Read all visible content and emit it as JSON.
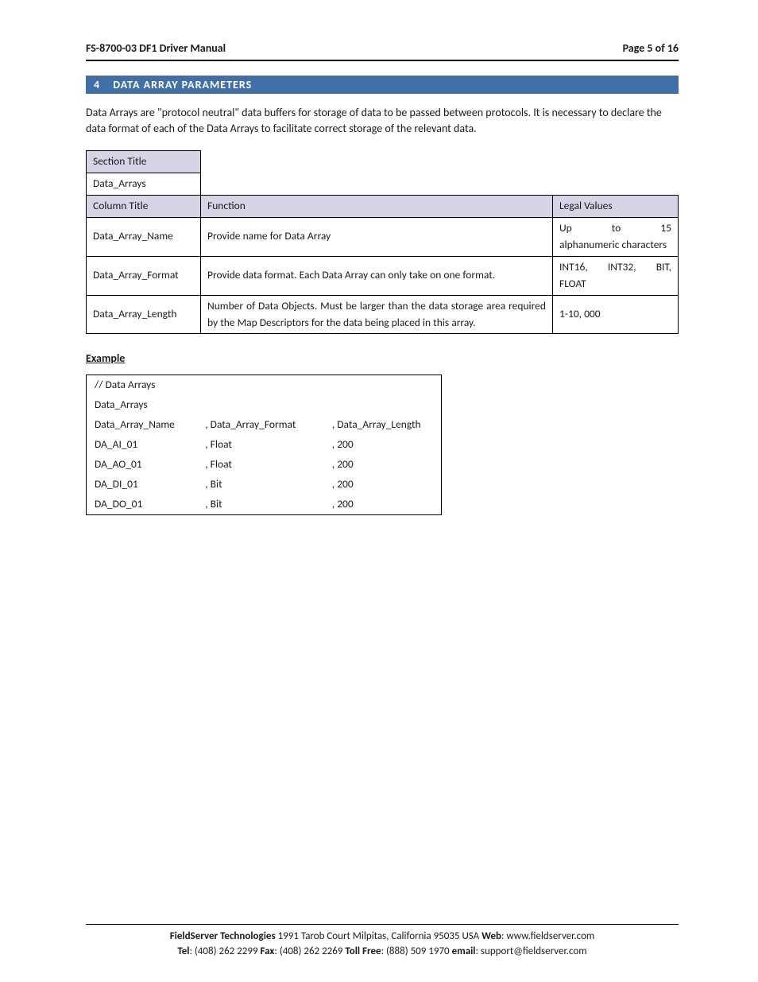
{
  "header": {
    "title": "FS-8700-03 DF1 Driver Manual",
    "page_text": "Page 5 of 16"
  },
  "section": {
    "number": "4",
    "title": "DATA ARRAY PARAMETERS"
  },
  "intro_text": "Data Arrays are \"protocol neutral\" data buffers for storage of data to be passed between protocols.  It is necessary to declare the data format of each of the Data Arrays to facilitate correct storage of the relevant data.",
  "params_table": {
    "section_title_label": "Section Title",
    "section_title_value": "Data_Arrays",
    "column_title_label": "Column Title",
    "function_label": "Function",
    "legal_values_label": "Legal Values",
    "rows": [
      {
        "name": "Data_Array_Name",
        "function": "Provide name for Data Array",
        "legal": "Up to 15 alphanumeric characters"
      },
      {
        "name": "Data_Array_Format",
        "function": "Provide data format. Each Data Array can only take on one format.",
        "legal": "INT16, INT32, BIT, FLOAT"
      },
      {
        "name": "Data_Array_Length",
        "function": "Number of Data Objects. Must be larger than the data storage area required by the Map Descriptors for the data being placed in this array.",
        "legal": "1-10, 000"
      }
    ]
  },
  "example_label": "Example",
  "example_table": {
    "comment": "//    Data Arrays",
    "section": "Data_Arrays",
    "headers": {
      "c1": "Data_Array_Name",
      "c2": ", Data_Array_Format",
      "c3": ", Data_Array_Length"
    },
    "rows": [
      {
        "c1": "DA_AI_01",
        "c2": ", Float",
        "c3": ", 200"
      },
      {
        "c1": "DA_AO_01",
        "c2": ", Float",
        "c3": ", 200"
      },
      {
        "c1": "DA_DI_01",
        "c2": ", Bit",
        "c3": ", 200"
      },
      {
        "c1": "DA_DO_01",
        "c2": ", Bit",
        "c3": ", 200"
      }
    ]
  },
  "footer": {
    "line1_company": "FieldServer Technologies",
    "line1_address": " 1991 Tarob Court Milpitas, California 95035 USA   ",
    "line1_web_label": "Web",
    "line1_web_value": ": www.fieldserver.com",
    "line2_tel_label": "Tel",
    "line2_tel_value": ": (408) 262 2299   ",
    "line2_fax_label": "Fax",
    "line2_fax_value": ": (408) 262 2269   ",
    "line2_tollfree_label": "Toll Free",
    "line2_tollfree_value": ": (888) 509 1970   ",
    "line2_email_label": "email",
    "line2_email_value": ": support@fieldserver.com"
  }
}
